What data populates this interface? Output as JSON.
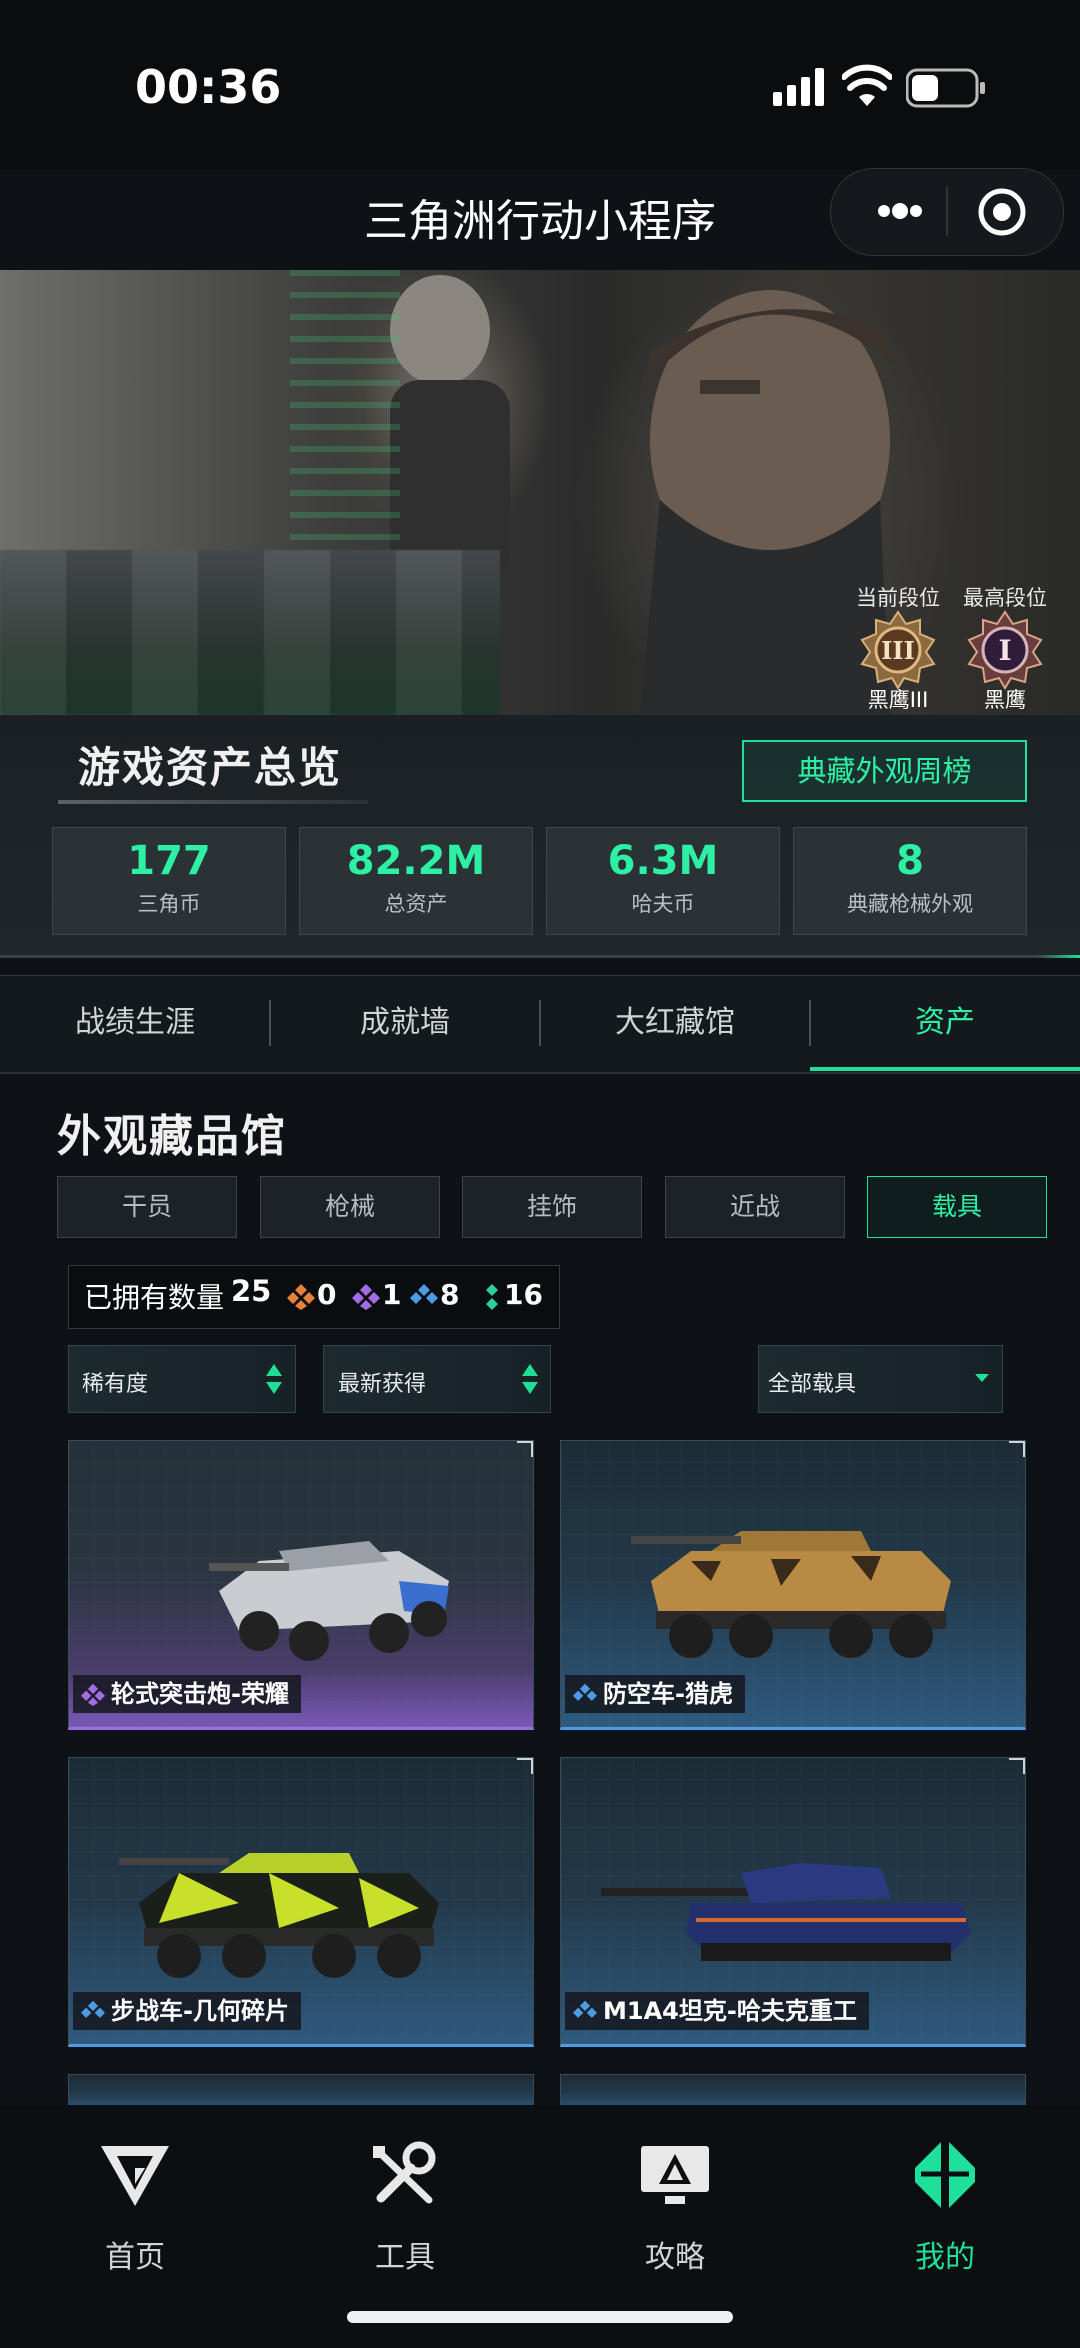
{
  "status": {
    "time": "00:36"
  },
  "nav": {
    "title": "三角洲行动小程序",
    "more_icon": "more-dots-icon",
    "close_icon": "target-circle-icon"
  },
  "rank": {
    "current_label": "当前段位",
    "current_name": "黑鹰III",
    "current_numeral": "III",
    "max_label": "最高段位",
    "max_name": "黑鹰",
    "max_numeral": "I"
  },
  "overview": {
    "title": "游戏资产总览",
    "weekly_button": "典藏外观周榜",
    "stats": [
      {
        "value": "177",
        "label": "三角币"
      },
      {
        "value": "82.2M",
        "label": "总资产"
      },
      {
        "value": "6.3M",
        "label": "哈夫币"
      },
      {
        "value": "8",
        "label": "典藏枪械外观"
      }
    ]
  },
  "tabs": [
    "战绩生涯",
    "成就墙",
    "大红藏馆",
    "资产"
  ],
  "active_tab": "资产",
  "collection": {
    "title": "外观藏品馆",
    "categories": [
      "干员",
      "枪械",
      "挂饰",
      "近战",
      "载具"
    ],
    "active_category": "载具",
    "owned_label": "已拥有数量",
    "owned_count": "25",
    "rarity_counts": [
      {
        "color": "#e6813a",
        "count": "0"
      },
      {
        "color": "#a46be6",
        "count": "1"
      },
      {
        "color": "#4d9be3",
        "count": "8"
      },
      {
        "color": "#2ed09a",
        "count": "16"
      }
    ],
    "filters": {
      "rarity": "稀有度",
      "sort": "最新获得",
      "type": "全部载具"
    },
    "items": [
      {
        "name": "轮式突击炮-荣耀",
        "rarity": "purple"
      },
      {
        "name": "防空车-猎虎",
        "rarity": "blue"
      },
      {
        "name": "步战车-几何碎片",
        "rarity": "blue"
      },
      {
        "name": "M1A4坦克-哈夫克重工",
        "rarity": "blue"
      }
    ]
  },
  "tabbar": [
    {
      "label": "首页",
      "icon": "delta-logo-icon"
    },
    {
      "label": "工具",
      "icon": "tools-icon"
    },
    {
      "label": "攻略",
      "icon": "monitor-guide-icon"
    },
    {
      "label": "我的",
      "icon": "profile-logo-icon"
    }
  ],
  "colors": {
    "accent": "#1fe09a",
    "background": "#0e1217",
    "purple": "#9a70e0",
    "blue": "#4d9be3"
  }
}
